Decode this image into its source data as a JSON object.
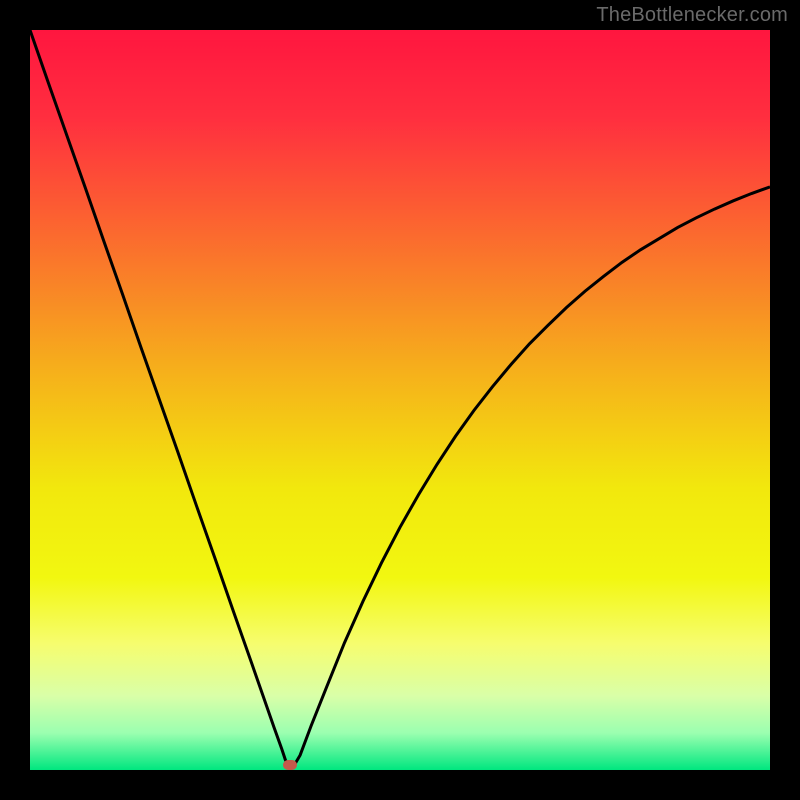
{
  "watermark": {
    "text": "TheBottlenecker.com"
  },
  "chart_data": {
    "type": "line",
    "title": "",
    "xlabel": "",
    "ylabel": "",
    "xlim": [
      0,
      100
    ],
    "ylim": [
      0,
      100
    ],
    "grid": false,
    "legend": false,
    "background_gradient": {
      "direction": "vertical",
      "stops": [
        {
          "pos": 0.0,
          "color": "#FF163F"
        },
        {
          "pos": 0.12,
          "color": "#FF2F3F"
        },
        {
          "pos": 0.28,
          "color": "#FB6B2E"
        },
        {
          "pos": 0.45,
          "color": "#F6AC1C"
        },
        {
          "pos": 0.62,
          "color": "#F2E80D"
        },
        {
          "pos": 0.74,
          "color": "#F2F710"
        },
        {
          "pos": 0.83,
          "color": "#F6FD6F"
        },
        {
          "pos": 0.9,
          "color": "#D9FFA8"
        },
        {
          "pos": 0.95,
          "color": "#9BFFB0"
        },
        {
          "pos": 1.0,
          "color": "#00E77F"
        }
      ]
    },
    "series": [
      {
        "name": "bottleneck-curve",
        "color": "#000000",
        "stroke_width": 3,
        "x": [
          0.0,
          2.5,
          5.0,
          7.5,
          10.0,
          12.5,
          15.0,
          17.5,
          20.0,
          22.5,
          25.0,
          27.5,
          30.0,
          31.5,
          33.0,
          34.0,
          34.5,
          35.0,
          35.5,
          36.5,
          38.0,
          40.0,
          42.5,
          45.0,
          47.5,
          50.0,
          52.5,
          55.0,
          57.5,
          60.0,
          62.5,
          65.0,
          67.5,
          70.0,
          72.5,
          75.0,
          77.5,
          80.0,
          82.5,
          85.0,
          87.5,
          90.0,
          92.5,
          95.0,
          97.5,
          100.0
        ],
        "y": [
          100.0,
          92.8,
          85.7,
          78.6,
          71.4,
          64.3,
          57.1,
          50.0,
          42.9,
          35.7,
          28.6,
          21.4,
          14.3,
          10.0,
          5.7,
          2.9,
          1.4,
          0.3,
          0.3,
          2.0,
          6.0,
          11.0,
          17.2,
          22.8,
          28.0,
          32.8,
          37.2,
          41.3,
          45.1,
          48.6,
          51.8,
          54.8,
          57.6,
          60.1,
          62.5,
          64.7,
          66.7,
          68.6,
          70.3,
          71.8,
          73.3,
          74.6,
          75.8,
          76.9,
          77.9,
          78.8
        ]
      }
    ],
    "marker": {
      "x": 35.2,
      "y": 0.7,
      "color": "#C45A4B",
      "shape": "rounded-rect"
    }
  }
}
